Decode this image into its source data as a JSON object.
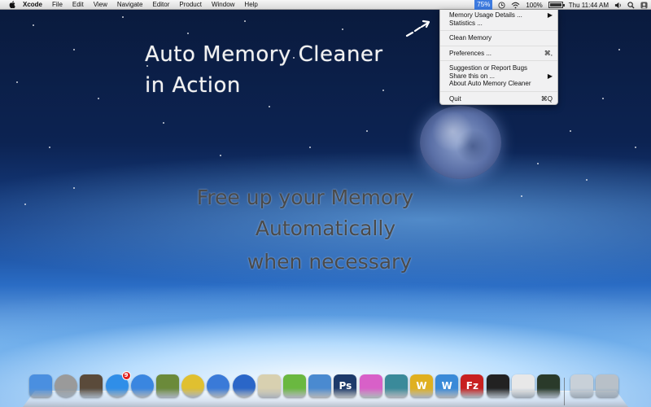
{
  "menubar": {
    "app_name": "Xcode",
    "menus": [
      "File",
      "Edit",
      "View",
      "Navigate",
      "Editor",
      "Product",
      "Window",
      "Help"
    ],
    "memory_percent": "75%",
    "battery_text": "100%",
    "clock": "Thu 11:44 AM",
    "icons": [
      "apple-icon",
      "clock-icon",
      "wifi-icon",
      "battery-icon",
      "volume-icon",
      "search-icon",
      "user-icon"
    ]
  },
  "dropdown": {
    "items": [
      {
        "label": "Memory Usage Details ...",
        "shortcut": "▶"
      },
      {
        "label": "Statistics ...",
        "shortcut": ""
      },
      {
        "label": "Clean Memory",
        "shortcut": ""
      },
      {
        "label": "Preferences ...",
        "shortcut": "⌘,"
      },
      {
        "label": "Suggestion or Report Bugs",
        "shortcut": ""
      },
      {
        "label": "Share this on ...",
        "shortcut": "▶"
      },
      {
        "label": "About Auto Memory Cleaner",
        "shortcut": ""
      },
      {
        "label": "Quit",
        "shortcut": "⌘Q"
      }
    ]
  },
  "desktop": {
    "title_line1": "Auto Memory Cleaner",
    "title_line2": "in Action",
    "tagline_line1": "Free up your Memory",
    "tagline_line2": "Automatically",
    "tagline_line3": "when necessary"
  },
  "dock": {
    "apps": [
      {
        "name": "finder-icon",
        "color": "#4a8fe0"
      },
      {
        "name": "launchpad-icon",
        "color": "#9a9a9a"
      },
      {
        "name": "mission-control-icon",
        "color": "#5a4a3a"
      },
      {
        "name": "app-store-icon",
        "color": "#2f8ee8",
        "badge": "9"
      },
      {
        "name": "safari-icon",
        "color": "#3a86e0"
      },
      {
        "name": "xcode-icon",
        "color": "#6b8a3a"
      },
      {
        "name": "chrome-icon",
        "color": "#e0c030"
      },
      {
        "name": "itunes-icon",
        "color": "#3a7ad8"
      },
      {
        "name": "quicktime-icon",
        "color": "#2a66c8"
      },
      {
        "name": "script-editor-icon",
        "color": "#d8d0b0"
      },
      {
        "name": "code-editor-icon",
        "color": "#6ab840"
      },
      {
        "name": "instruments-icon",
        "color": "#4a8ad0"
      },
      {
        "name": "photoshop-icon",
        "color": "#1d3a6a",
        "text": "Ps"
      },
      {
        "name": "flower-app-icon",
        "color": "#d860c8"
      },
      {
        "name": "terminal-arrow-icon",
        "color": "#3a8a9a"
      },
      {
        "name": "wordpress-w-icon",
        "color": "#e0b020",
        "text": "W"
      },
      {
        "name": "word-w-icon",
        "color": "#3a8ad8",
        "text": "W"
      },
      {
        "name": "filezilla-icon",
        "color": "#c82020",
        "text": "Fz"
      },
      {
        "name": "terminal-icon",
        "color": "#222222"
      },
      {
        "name": "textedit-icon",
        "color": "#e8e8e8"
      },
      {
        "name": "activity-monitor-icon",
        "color": "#2a3a2a"
      },
      {
        "name": "downloads-stack-icon",
        "color": "#c8d0d8"
      },
      {
        "name": "trash-icon",
        "color": "#b8c0c8"
      }
    ]
  },
  "colors": {
    "menubar_highlight": "#3d7be0",
    "chalk_white": "#f2f2f2",
    "chalk_dark": "#4a4a4a"
  }
}
